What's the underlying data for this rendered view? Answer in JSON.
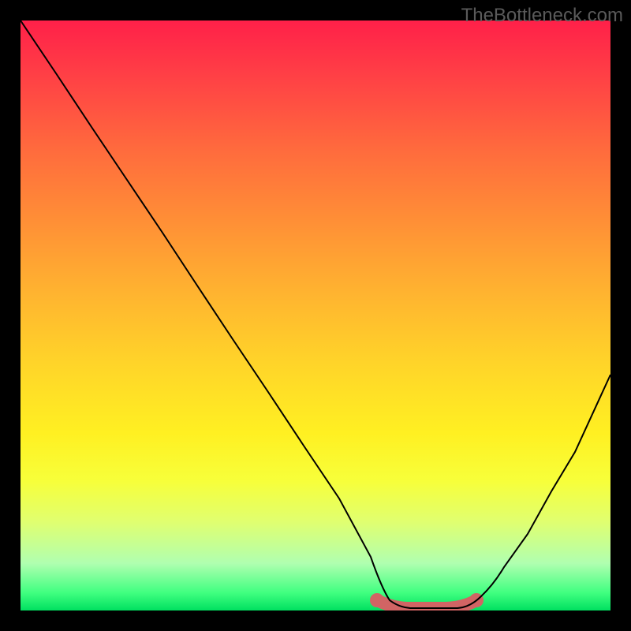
{
  "watermark": "TheBottleneck.com",
  "chart_data": {
    "type": "line",
    "title": "",
    "xlabel": "",
    "ylabel": "",
    "xlim": [
      0,
      100
    ],
    "ylim": [
      0,
      100
    ],
    "gradient_background": true,
    "series": [
      {
        "name": "curve",
        "x": [
          0,
          6,
          12,
          18,
          24,
          30,
          36,
          42,
          48,
          54,
          60,
          62,
          66,
          70,
          74,
          78,
          82,
          86,
          90,
          94,
          100
        ],
        "y": [
          100,
          91,
          82,
          73,
          64,
          55,
          46,
          37,
          28,
          19,
          8,
          2,
          0,
          0,
          0,
          2,
          7,
          13,
          20,
          27,
          40
        ]
      }
    ],
    "highlight_range": {
      "x_start": 60,
      "x_end": 78,
      "y": 0
    },
    "background_gradient_stops": [
      {
        "pos": 0,
        "color": "#ff2049"
      },
      {
        "pos": 10,
        "color": "#ff4245"
      },
      {
        "pos": 22,
        "color": "#ff6b3d"
      },
      {
        "pos": 34,
        "color": "#ff8f36"
      },
      {
        "pos": 46,
        "color": "#ffb330"
      },
      {
        "pos": 58,
        "color": "#ffd429"
      },
      {
        "pos": 70,
        "color": "#fff022"
      },
      {
        "pos": 78,
        "color": "#f7ff3a"
      },
      {
        "pos": 85,
        "color": "#e0ff70"
      },
      {
        "pos": 92,
        "color": "#b0ffb0"
      },
      {
        "pos": 97,
        "color": "#40ff80"
      },
      {
        "pos": 100,
        "color": "#00e060"
      }
    ]
  }
}
